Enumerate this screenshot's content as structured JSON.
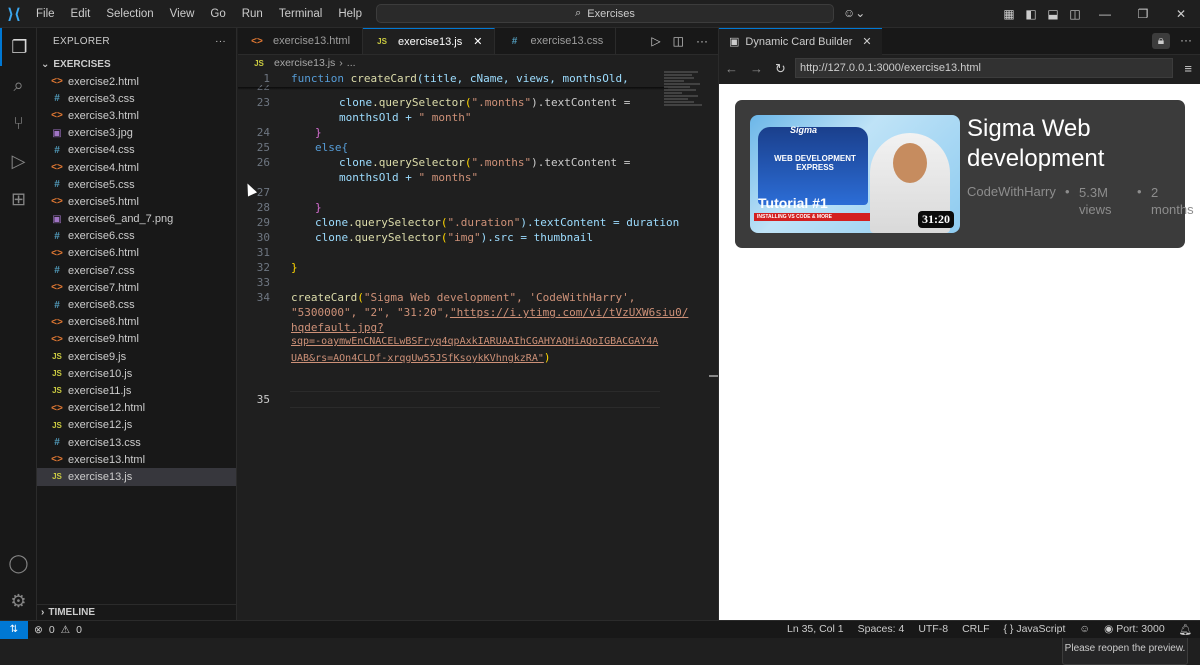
{
  "titlebar": {
    "menu": [
      "File",
      "Edit",
      "Selection",
      "View",
      "Go",
      "Run",
      "Terminal",
      "Help"
    ],
    "search": "Exercises"
  },
  "explorer": {
    "header": "EXPLORER",
    "folder": "EXERCISES",
    "files": [
      {
        "name": "exercise2.html",
        "type": "html"
      },
      {
        "name": "exercise3.css",
        "type": "css"
      },
      {
        "name": "exercise3.html",
        "type": "html"
      },
      {
        "name": "exercise3.jpg",
        "type": "img"
      },
      {
        "name": "exercise4.css",
        "type": "css"
      },
      {
        "name": "exercise4.html",
        "type": "html"
      },
      {
        "name": "exercise5.css",
        "type": "css"
      },
      {
        "name": "exercise5.html",
        "type": "html"
      },
      {
        "name": "exercise6_and_7.png",
        "type": "img"
      },
      {
        "name": "exercise6.css",
        "type": "css"
      },
      {
        "name": "exercise6.html",
        "type": "html"
      },
      {
        "name": "exercise7.css",
        "type": "css"
      },
      {
        "name": "exercise7.html",
        "type": "html"
      },
      {
        "name": "exercise8.css",
        "type": "css"
      },
      {
        "name": "exercise8.html",
        "type": "html"
      },
      {
        "name": "exercise9.html",
        "type": "html"
      },
      {
        "name": "exercise9.js",
        "type": "js"
      },
      {
        "name": "exercise10.js",
        "type": "js"
      },
      {
        "name": "exercise11.js",
        "type": "js"
      },
      {
        "name": "exercise12.html",
        "type": "html"
      },
      {
        "name": "exercise12.js",
        "type": "js"
      },
      {
        "name": "exercise13.css",
        "type": "css"
      },
      {
        "name": "exercise13.html",
        "type": "html"
      },
      {
        "name": "exercise13.js",
        "type": "js",
        "selected": true
      }
    ],
    "timeline": "TIMELINE"
  },
  "editor": {
    "tabs": [
      {
        "label": "exercise13.html",
        "type": "html"
      },
      {
        "label": "exercise13.js",
        "type": "js",
        "active": true
      },
      {
        "label": "exercise13.css",
        "type": "css"
      }
    ],
    "breadcrumb": {
      "file": "exercise13.js",
      "rest": "..."
    },
    "code": {
      "l1": "1",
      "l22": "22",
      "l23": "23",
      "l24": "24",
      "l25": "25",
      "l26": "26",
      "l27": "27",
      "l28": "28",
      "l29": "29",
      "l30": "30",
      "l31": "31",
      "l32": "32",
      "l33": "33",
      "l34": "34",
      "l35": "35",
      "sticky_kw": "function",
      "sticky_fn": "createCard",
      "sticky_args": "(title, cName, views, monthsOld,",
      "c23a_var": "clone",
      "c23a_fn": ".querySelector",
      "c23a_str": "\".months\"",
      "c23a_rest": ").textContent =",
      "c23b": "monthsOld + ",
      "c23b_str": "\" month\"",
      "c24": "}",
      "c25": "else{",
      "c26a_var": "clone",
      "c26a_fn": ".querySelector",
      "c26a_str": "\".months\"",
      "c26a_rest": ").textContent =",
      "c26b": "monthsOld + ",
      "c26b_str": "\" months\"",
      "c28": "}",
      "c29_var": "clone",
      "c29_fn": ".querySelector",
      "c29_str": "\".duration\"",
      "c29_rest": ").textContent = duration",
      "c30_var": "clone",
      "c30_fn": ".querySelector",
      "c30_str": "\"img\"",
      "c30_rest": ").src = thumbnail",
      "c32": "}",
      "c34a_fn": "createCard",
      "c34a_str": "\"Sigma Web development\", 'CodeWithHarry',",
      "c34b_str": "\"5300000\", \"2\", \"31:20\",",
      "c34b_url": "\"https://i.ytimg.com/vi/tVzUXW6siu0/",
      "c34c_url": "hqdefault.jpg?",
      "c34d_url": "sqp=-oaymwEnCNACELwBSFryq4qpAxkIARUAAIhCGAHYAQHiAQoIGBACGAY4A",
      "c34e_url": "UAB&rs=AOn4CLDf-xrqgUw55JSfKsoykKVhngkzRA\"",
      "c34e_rest": ")"
    }
  },
  "preview": {
    "tab_label": "Dynamic Card Builder",
    "url": "http://127.0.0.1:3000/exercise13.html",
    "card": {
      "title": "Sigma Web development",
      "channel": "CodeWithHarry",
      "views_num": "5.3M",
      "views_label": "views",
      "months_num": "2",
      "months_label": "months",
      "duration": "31:20",
      "thumb_text": "Tutorial #1",
      "thumb_sub": "INSTALLING VS CODE & MORE",
      "thumb_banner": "WEB DEVELOPMENT EXPRESS",
      "thumb_top": "Sigma"
    },
    "toast": "Please reopen the preview."
  },
  "statusbar": {
    "errors": "0",
    "warnings": "0",
    "position": "Ln 35, Col 1",
    "spaces": "Spaces: 4",
    "encoding": "UTF-8",
    "eol": "CRLF",
    "language": "JavaScript",
    "port": "Port: 3000"
  }
}
